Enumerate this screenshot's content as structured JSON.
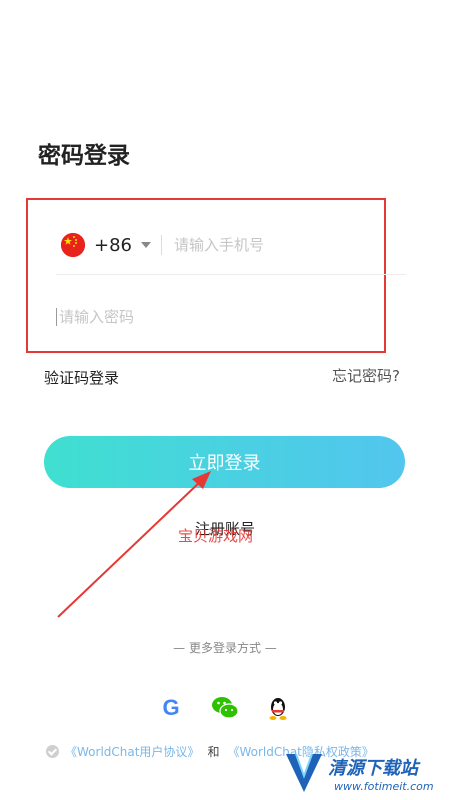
{
  "page": {
    "title": "密码登录"
  },
  "phone": {
    "country_code": "+86",
    "placeholder": "请输入手机号"
  },
  "password": {
    "placeholder": "请输入密码"
  },
  "links": {
    "sms_login": "验证码登录",
    "forgot_password": "忘记密码?"
  },
  "login_button": "立即登录",
  "register": "注册账号",
  "watermark_text": "宝贝游戏网",
  "more_login": "— 更多登录方式 —",
  "social_icons": [
    "google-icon",
    "wechat-icon",
    "qq-icon"
  ],
  "agreement": {
    "user_agreement": "《WorldChat用户协议》",
    "and": "和",
    "privacy_policy": "《WorldChat隐私权政策》"
  },
  "site_logo": {
    "text": "清源下载站",
    "url": "www.fotimeit.com"
  },
  "colors": {
    "button_gradient_start": "#3fe0d0",
    "button_gradient_end": "#52c6ee",
    "highlight": "#e53935",
    "link": "#7ab7e8"
  }
}
